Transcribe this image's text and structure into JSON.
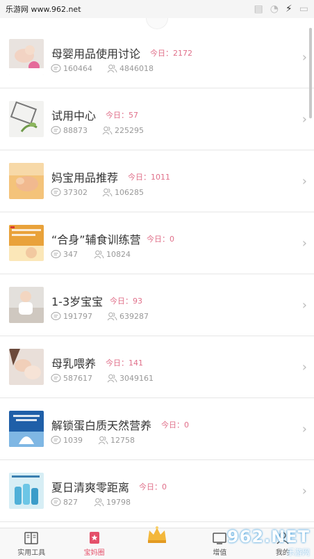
{
  "status_bar": {
    "watermark": "乐游网 www.962.net"
  },
  "forums": [
    {
      "title": "母婴用品使用讨论",
      "today": "今日：2172",
      "posts": "160464",
      "members": "4846018"
    },
    {
      "title": "试用中心",
      "today": "今日：57",
      "posts": "88873",
      "members": "225295"
    },
    {
      "title": "妈宝用品推荐",
      "today": "今日：1011",
      "posts": "37302",
      "members": "106285"
    },
    {
      "title": "“合身”辅食训练营",
      "today": "今日：0",
      "posts": "347",
      "members": "10824"
    },
    {
      "title": "1-3岁宝宝",
      "today": "今日：93",
      "posts": "191797",
      "members": "639287"
    },
    {
      "title": "母乳喂养",
      "today": "今日：141",
      "posts": "587617",
      "members": "3049161"
    },
    {
      "title": "解锁蛋白质天然营养",
      "today": "今日：0",
      "posts": "1039",
      "members": "12758"
    },
    {
      "title": "夏日清爽零距离",
      "today": "今日：0",
      "posts": "827",
      "members": "19798"
    }
  ],
  "tabbar": {
    "tabs": [
      {
        "label": "实用工具"
      },
      {
        "label": "宝妈圈"
      },
      {
        "label": ""
      },
      {
        "label": "增值"
      },
      {
        "label": "我的"
      }
    ]
  },
  "watermark_bottom": {
    "main": "962.NET",
    "sub": "乐游网"
  },
  "colors": {
    "accent": "#e4506a",
    "today": "#e0708a"
  }
}
